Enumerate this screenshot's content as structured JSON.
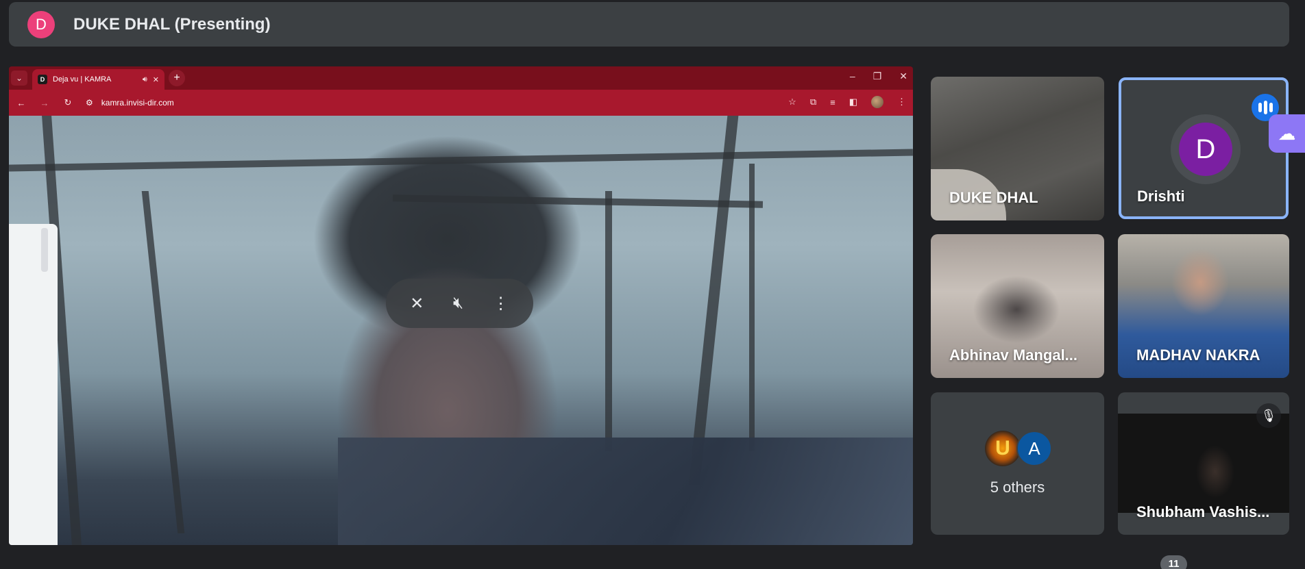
{
  "presenter_bar": {
    "avatar_letter": "D",
    "title": "DUKE DHAL (Presenting)"
  },
  "shared_screen": {
    "browser": {
      "tab_title": "Deja vu | KAMRA",
      "favicon_letter": "D",
      "url": "kamra.invisi-dir.com"
    },
    "controls": {
      "icons": [
        "unpin-icon",
        "volume-off-icon",
        "more-vert-icon"
      ]
    }
  },
  "tiles": [
    {
      "name": "DUKE DHAL"
    },
    {
      "name": "Drishti",
      "avatar_letter": "D",
      "speaking": true
    },
    {
      "name": "Abhinav Mangal..."
    },
    {
      "name": "MADHAV NAKRA"
    },
    {
      "others_label": "5 others",
      "avatars": [
        "U",
        "A"
      ]
    },
    {
      "name": "Shubham Vashis...",
      "muted": true
    }
  ],
  "participant_count": "11",
  "colors": {
    "background": "#202124",
    "tile": "#3c4043",
    "presenter_avatar": "#ec407a",
    "drishti_avatar": "#7b1fa2",
    "speaking_border": "#8ab4f8",
    "browser_tab_bar": "#780f1c",
    "browser_toolbar": "#a8182d"
  }
}
